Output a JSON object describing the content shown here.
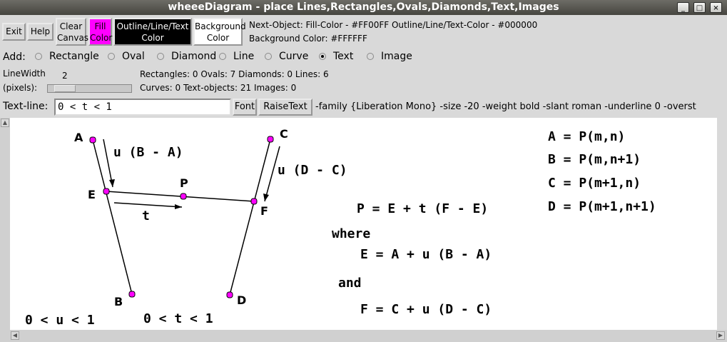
{
  "window": {
    "title": "wheeeDiagram - place Lines,Rectangles,Ovals,Diamonds,Text,Images",
    "controls": [
      "_",
      "□",
      "×"
    ]
  },
  "toolbar": {
    "exit": "Exit",
    "help": "Help",
    "clear_canvas": [
      "Clear",
      "Canvas"
    ],
    "fill_color": [
      "Fill",
      "Color"
    ],
    "outline_color": [
      "Outline/Line/Text",
      "Color"
    ],
    "background_color": [
      "Background",
      "Color"
    ],
    "next_object_line": "Next-Object:  Fill-Color - #FF00FF    Outline/Line/Text-Color - #000000",
    "background_line": "Background Color: #FFFFFF",
    "fill_hex": "#FF00FF",
    "outline_hex": "#000000",
    "bg_hex": "#FFFFFF"
  },
  "add_row": {
    "label": "Add:",
    "options": [
      "Rectangle",
      "Oval",
      "Diamond",
      "Line",
      "Curve",
      "Text",
      "Image"
    ],
    "selected": "Text"
  },
  "linewidth": {
    "label1": "LineWidth",
    "label2": "(pixels):",
    "value": "2",
    "slider_fraction": 0.1
  },
  "counts": {
    "row1": "Rectangles: 0    Ovals: 7    Diamonds: 0    Lines: 6",
    "row2": "Curves: 0    Text-objects: 21    Images: 0"
  },
  "textline": {
    "label": "Text-line:",
    "value": "0 < t < 1",
    "font_button": "Font",
    "raise_button": "RaiseText",
    "font_spec": "-family {Liberation Mono} -size -20 -weight bold -slant roman -underline 0 -overst"
  },
  "canvas": {
    "points": {
      "A": "A",
      "B": "B",
      "C": "C",
      "D": "D",
      "E": "E",
      "F": "F",
      "P": "P",
      "t": "t"
    },
    "labels": {
      "uBA": "u (B - A)",
      "uDC": "u (D - C)",
      "eqP": "P = E + t (F - E)",
      "where": "where",
      "eqE": "E = A + u (B - A)",
      "and": "and",
      "eqF": "F = C + u (D - C)",
      "urange": "0 < u < 1",
      "trange": "0 < t < 1",
      "defA": "A = P(m,n)",
      "defB": "B = P(m,n+1)",
      "defC": "C = P(m+1,n)",
      "defD": "D = P(m+1,n+1)"
    },
    "marker_color": "#FF00FF"
  }
}
